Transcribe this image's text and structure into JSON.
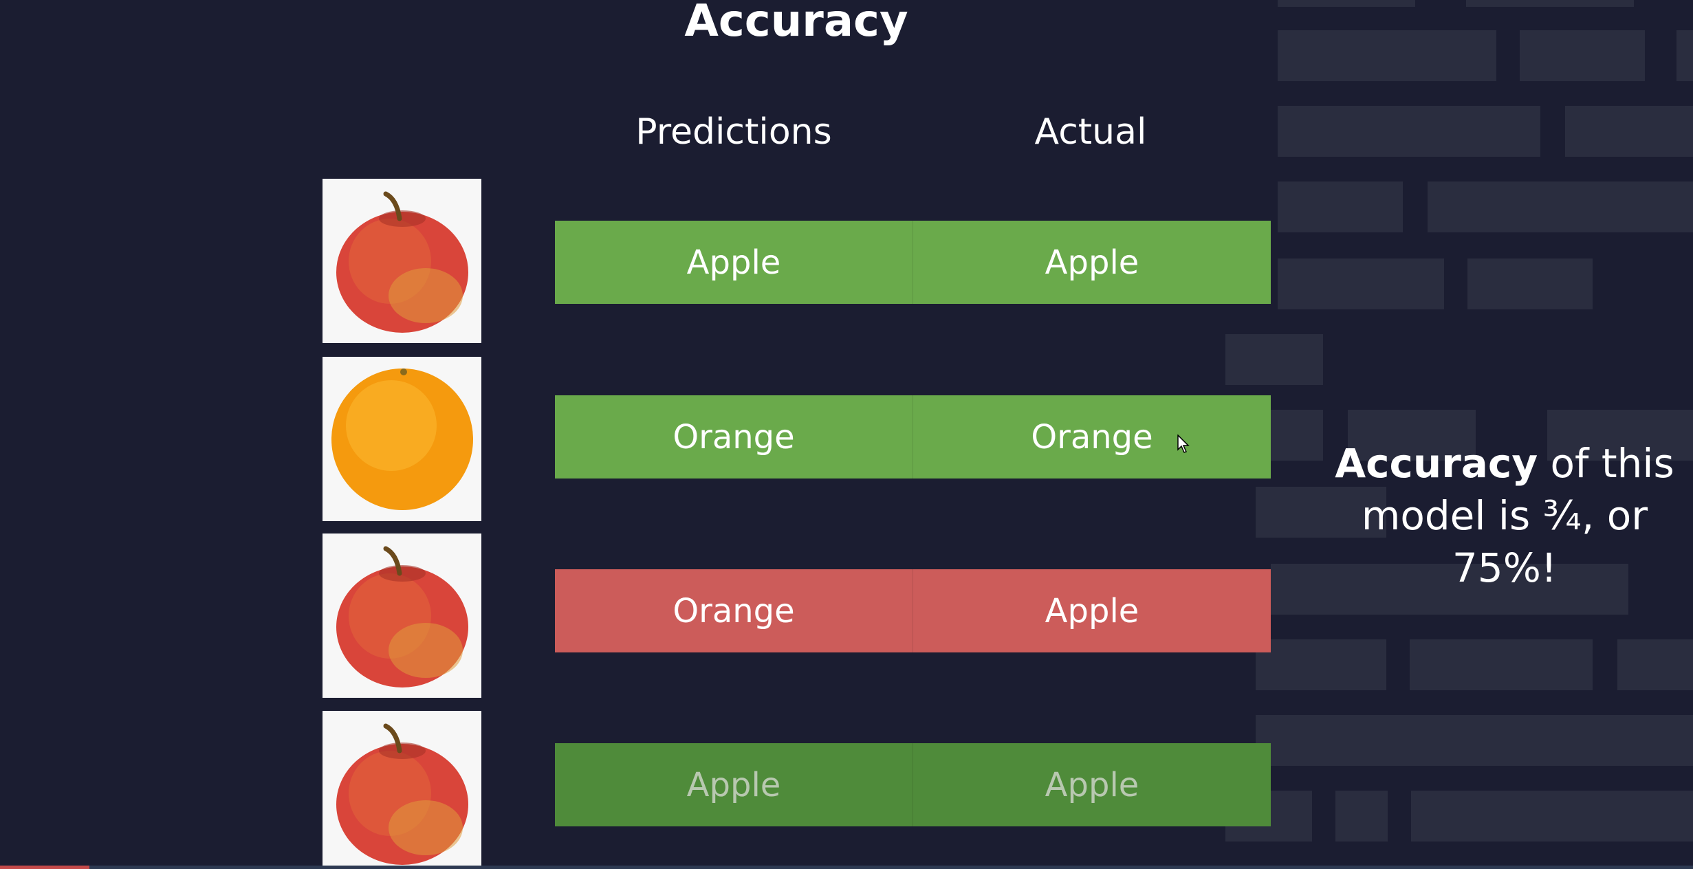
{
  "title": "Accuracy",
  "headers": {
    "predictions": "Predictions",
    "actual": "Actual"
  },
  "rows": [
    {
      "image": "apple-icon",
      "prediction": "Apple",
      "actual": "Apple",
      "result": "correct"
    },
    {
      "image": "orange-icon",
      "prediction": "Orange",
      "actual": "Orange",
      "result": "correct"
    },
    {
      "image": "apple-icon",
      "prediction": "Orange",
      "actual": "Apple",
      "result": "wrong"
    },
    {
      "image": "apple-icon",
      "prediction": "Apple",
      "actual": "Apple",
      "result": "correct"
    }
  ],
  "summary": {
    "bold": "Accuracy",
    "rest": " of this model is ¾, or 75%!"
  },
  "colors": {
    "background": "#1b1d31",
    "correct": "#6aaa4b",
    "wrong": "#cc5c5a"
  }
}
